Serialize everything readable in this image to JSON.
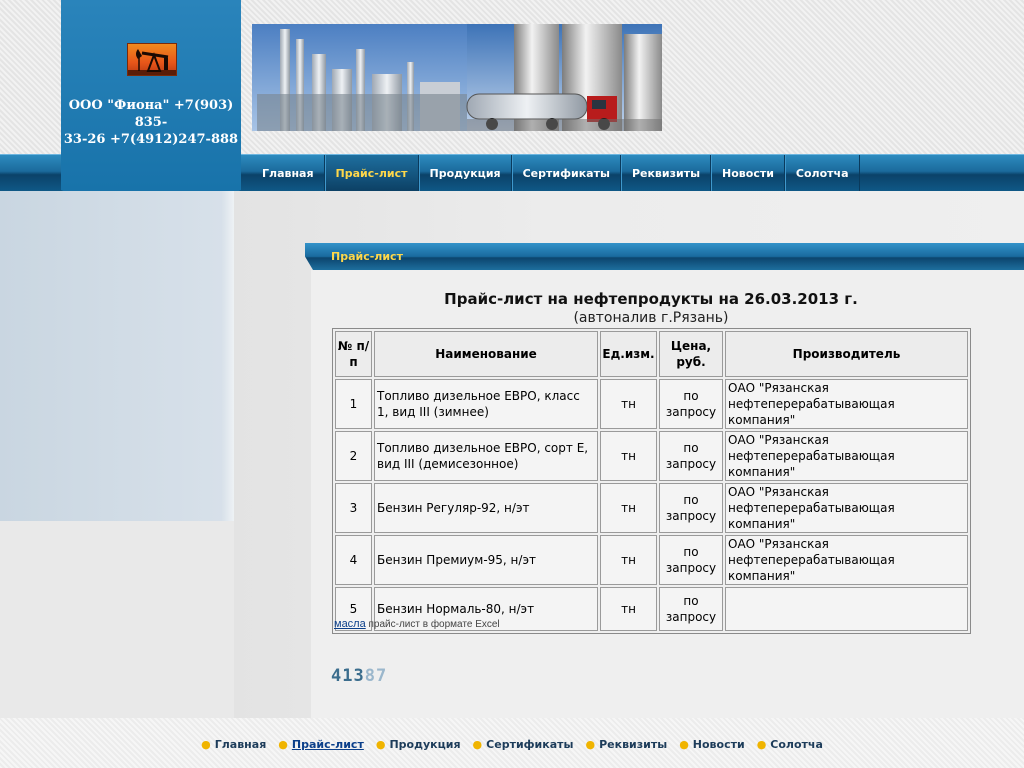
{
  "company": {
    "name_line1": "ООО \"Фиона\" +7(903) 835-",
    "name_line2": "33-26 +7(4912)247-888"
  },
  "nav": {
    "items": [
      {
        "label": "Главная",
        "active": false
      },
      {
        "label": "Прайс-лист",
        "active": true
      },
      {
        "label": "Продукция",
        "active": false
      },
      {
        "label": "Сертификаты",
        "active": false
      },
      {
        "label": "Реквизиты",
        "active": false
      },
      {
        "label": "Новости",
        "active": false
      },
      {
        "label": "Солотча",
        "active": false
      }
    ]
  },
  "section": {
    "title": "Прайс-лист"
  },
  "price": {
    "title": "Прайс-лист на нефтепродукты на 26.03.2013 г.",
    "subtitle": "(автоналив г.Рязань)",
    "headers": {
      "num": "№ п/п",
      "name": "Наименование",
      "unit": "Ед.изм.",
      "price": "Цена, руб.",
      "maker": "Производитель"
    },
    "rows": [
      {
        "num": "1",
        "name": "Топливо дизельное ЕВРО, класс 1, вид III (зимнее)",
        "unit": "тн",
        "price": "по запросу",
        "maker": "ОАО \"Рязанская нефтеперерабатывающая компания\""
      },
      {
        "num": "2",
        "name": "Топливо дизельное ЕВРО, сорт Е, вид III (демисезонное)",
        "unit": "тн",
        "price": "по запросу",
        "maker": "ОАО \"Рязанская нефтеперерабатывающая компания\""
      },
      {
        "num": "3",
        "name": "Бензин Регуляр-92, н/эт",
        "unit": "тн",
        "price": "по запросу",
        "maker": "ОАО \"Рязанская нефтеперерабатывающая компания\""
      },
      {
        "num": "4",
        "name": "Бензин Премиум-95, н/эт",
        "unit": "тн",
        "price": "по запросу",
        "maker": "ОАО \"Рязанская нефтеперерабатывающая компания\""
      },
      {
        "num": "5",
        "name": "Бензин Нормаль-80, н/эт",
        "unit": "тн",
        "price": "по запросу",
        "maker": ""
      }
    ]
  },
  "excel": {
    "link": "масла",
    "text": " прайс-лист в формате Excel"
  },
  "counter": {
    "value_a": "413",
    "value_b": "87"
  },
  "footer": {
    "items": [
      {
        "label": "Главная",
        "active": false
      },
      {
        "label": "Прайс-лист",
        "active": true
      },
      {
        "label": "Продукция",
        "active": false
      },
      {
        "label": "Сертификаты",
        "active": false
      },
      {
        "label": "Реквизиты",
        "active": false
      },
      {
        "label": "Новости",
        "active": false
      },
      {
        "label": "Солотча",
        "active": false
      }
    ]
  },
  "colors": {
    "accent_blue": "#1873aa",
    "nav_active_text": "#ffd84a",
    "footer_dot": "#f0b400"
  },
  "icons": {
    "logo": "oil-pumpjack-logo"
  }
}
